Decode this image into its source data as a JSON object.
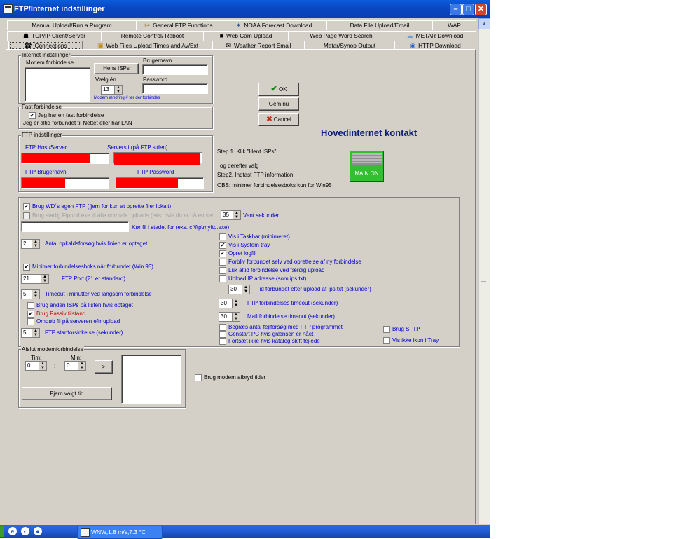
{
  "window": {
    "title": "FTP/Internet indstillinger"
  },
  "tabs": {
    "row1": [
      {
        "label": "Manual Upload/Run a Program",
        "icon": ""
      },
      {
        "label": "General FTP Functions",
        "icon": "tools-icon"
      },
      {
        "label": "NOAA Forecast Download",
        "icon": "satellite-icon"
      },
      {
        "label": "Data File Upload/Email",
        "icon": ""
      },
      {
        "label": "WAP",
        "icon": ""
      }
    ],
    "row2": [
      {
        "label": "TCP/IP Client/Server",
        "icon": "network-icon"
      },
      {
        "label": "Remote Control/ Reboot",
        "icon": ""
      },
      {
        "label": "Web Cam Upload",
        "icon": "webcam-icon"
      },
      {
        "label": "Web Page Word Search",
        "icon": ""
      },
      {
        "label": "METAR Download",
        "icon": "cloud-icon"
      }
    ],
    "row3": [
      {
        "label": "Connections",
        "icon": "connection-icon"
      },
      {
        "label": "Web Files Upload Times and Av/Ext",
        "icon": "folder-icon"
      },
      {
        "label": "Weather Report Email",
        "icon": "email-icon"
      },
      {
        "label": "Metar/Synop Output",
        "icon": ""
      },
      {
        "label": "HTTP Download",
        "icon": "http-icon"
      }
    ]
  },
  "internet": {
    "legend": "Internet indstillinger",
    "modem_label": "Modem forbindelse",
    "hent_isps": "Hens ISPs",
    "vaelg_en": "Vælg én",
    "vaelg_value": "13",
    "brugernavn_label": "Brugernavn",
    "password_label": "Password",
    "modem_note": "Modem ændring # før der forbindes"
  },
  "fast": {
    "legend": "Fast forbindelse",
    "checkbox": "Jeg har en fast forbindelse",
    "note": "Jeg er altid forbundet til Nettet eller har LAN"
  },
  "ftp": {
    "legend": "FTP indstillinger",
    "host": "FTP Host/Server",
    "serversti": "Serversti (på FTP siden)",
    "brugernavn": "FTP Brugernavn",
    "password": "FTP Password"
  },
  "actions": {
    "ok": "OK",
    "gem": "Gem nu",
    "cancel": "Cancel"
  },
  "main_contact": {
    "title": "Hovedinternet kontakt",
    "step1": "Step 1. Klik \"Hent ISPs\"",
    "step1b": "og derefter valg",
    "step2": "Step2. Indtast FTP information",
    "obs": "OBS: minimer forbindelsesboks kun for Win95",
    "switch_label": "MAIN ON"
  },
  "options": {
    "wd_ftp": "Brug WD´s egen FTP  (fjern for kun at oprette filer lokalt)",
    "ftpupd": "Brug stadig Ftpupd.exe til alle normale uploads (eks. hvis du er på en ser",
    "vent_value": "35",
    "vent": "Vent sekunder",
    "run_file": "Kør fil i stedet for (eks. c:\\ftp\\myftp.exe)",
    "retries_value": "2",
    "retries": "Antal opkaldsforsøg hvis linien er optaget",
    "minimize": "Minimer forbindelsesboks når forbundet (Win 95)",
    "port_value": "21",
    "port": "FTP Port (21 er standard)",
    "timeout_value": "5",
    "timeout": "Timeout i minutter ved langsom forbindelse",
    "other_isps": "Brug anden ISPs på listen hvis optaget",
    "passive": "Brug Passiv tilstand",
    "rename": "Omdøb fil på serveren eftr upload",
    "start_delay_value": "5",
    "start_delay": "FTP startforsinkelse (sekunder)",
    "taskbar": "Vis i Taskbar (minimeret)",
    "systray": "Vis i System tray",
    "logfile": "Opret logfil",
    "stay_connected": "Forbliv forbundet selv ved oprettelse af ny forbindelse",
    "always_close": "Luk altid forbindelse ved færdig upload",
    "upload_ip": "Upload IP adresse (som ips.txt)",
    "ip_time_value": "30",
    "ip_time": "Tid forbundet efter upload af ips.txt (sekunder)",
    "ftp_timeout_value": "30",
    "ftp_timeout": "FTP forbindelses timeout (sekunder)",
    "mail_timeout_value": "30",
    "mail_timeout": "Mail forbindelse timeout (sekunder)",
    "limit_retries": "Begræs antal fejlforsøg med FTP programmet",
    "restart_pc": "Genstart PC hvis grænsen er nået",
    "no_continue": "Fortsæt ikke hvis katalog skift fejlede",
    "sftp": "Brug SFTP",
    "no_tray_icon": "Vis ikke ikon i Tray"
  },
  "hangup": {
    "legend": "Afslut modemforbindelse",
    "tim": "Tim:",
    "min": "Min:",
    "tim_value": "0",
    "min_value": "0",
    "colon": ":",
    "arrow": ">",
    "delete": "Fjern valgt tid",
    "use_times": "Brug modem afbryd tider"
  },
  "taskbar": {
    "item": "WNW,1.8 m/s,7.3 °C"
  }
}
